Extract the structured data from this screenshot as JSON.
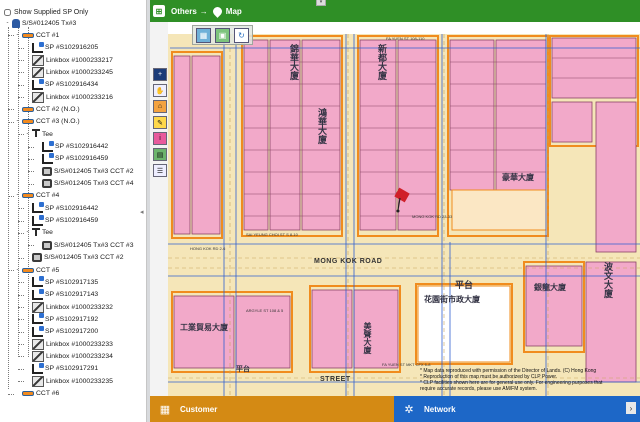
{
  "tree": {
    "show_supplied_label": "Show Supplied SP Only",
    "nodes": [
      {
        "label": "S/S#012405 Tx#3",
        "icon": "root",
        "indent": 0,
        "toggle": "-"
      },
      {
        "label": "CCT #1",
        "icon": "cct",
        "indent": 1,
        "toggle": "-"
      },
      {
        "label": "SP #S102916205",
        "icon": "sp",
        "indent": 2,
        "toggle": ""
      },
      {
        "label": "Linkbox #1000233217",
        "icon": "link",
        "indent": 2,
        "toggle": ""
      },
      {
        "label": "Linkbox #1000233245",
        "icon": "link",
        "indent": 2,
        "toggle": ""
      },
      {
        "label": "SP #S102916434",
        "icon": "sp",
        "indent": 2,
        "toggle": ""
      },
      {
        "label": "Linkbox #1000233216",
        "icon": "link",
        "indent": 2,
        "toggle": ""
      },
      {
        "label": "CCT #2 (N.O.)",
        "icon": "cct",
        "indent": 1,
        "toggle": ""
      },
      {
        "label": "CCT #3 (N.O.)",
        "icon": "cct",
        "indent": 1,
        "toggle": "-"
      },
      {
        "label": "Tee",
        "icon": "tee",
        "indent": 2,
        "toggle": "-"
      },
      {
        "label": "SP #S102916442",
        "icon": "sp",
        "indent": 3,
        "toggle": ""
      },
      {
        "label": "SP #S102916459",
        "icon": "sp",
        "indent": 3,
        "toggle": ""
      },
      {
        "label": "S/S#012405 Tx#3 CCT #2",
        "icon": "tx",
        "indent": 3,
        "toggle": ""
      },
      {
        "label": "S/S#012405 Tx#3 CCT #4",
        "icon": "tx",
        "indent": 3,
        "toggle": ""
      },
      {
        "label": "CCT #4",
        "icon": "cct",
        "indent": 1,
        "toggle": "-"
      },
      {
        "label": "SP #S102916442",
        "icon": "sp",
        "indent": 2,
        "toggle": ""
      },
      {
        "label": "SP #S102916459",
        "icon": "sp",
        "indent": 2,
        "toggle": ""
      },
      {
        "label": "Tee",
        "icon": "tee",
        "indent": 2,
        "toggle": "-"
      },
      {
        "label": "S/S#012405 Tx#3 CCT #3",
        "icon": "tx",
        "indent": 3,
        "toggle": ""
      },
      {
        "label": "S/S#012405 Tx#3 CCT #2",
        "icon": "tx",
        "indent": 2,
        "toggle": ""
      },
      {
        "label": "CCT #5",
        "icon": "cct",
        "indent": 1,
        "toggle": "-"
      },
      {
        "label": "SP #S102917135",
        "icon": "sp",
        "indent": 2,
        "toggle": ""
      },
      {
        "label": "SP #S102917143",
        "icon": "sp",
        "indent": 2,
        "toggle": ""
      },
      {
        "label": "Linkbox #1000233232",
        "icon": "link",
        "indent": 2,
        "toggle": ""
      },
      {
        "label": "SP #S102917192",
        "icon": "sp",
        "indent": 2,
        "toggle": ""
      },
      {
        "label": "SP #S102917200",
        "icon": "sp",
        "indent": 2,
        "toggle": ""
      },
      {
        "label": "Linkbox #1000233233",
        "icon": "link",
        "indent": 2,
        "toggle": ""
      },
      {
        "label": "Linkbox #1000233234",
        "icon": "link",
        "indent": 2,
        "toggle": ""
      },
      {
        "label": "SP #S102917291",
        "icon": "sp",
        "indent": 2,
        "toggle": ""
      },
      {
        "label": "Linkbox #1000233235",
        "icon": "link",
        "indent": 2,
        "toggle": ""
      },
      {
        "label": "CCT #6",
        "icon": "cct",
        "indent": 1,
        "toggle": ""
      }
    ]
  },
  "header": {
    "title_left": "Others",
    "arrow": "→",
    "title_right": "Map"
  },
  "map": {
    "roads": {
      "mong_kok": "MONG KOK ROAD",
      "street_bottom": "STREET"
    },
    "buildings": [
      {
        "text": "錦華大廈"
      },
      {
        "text": "新都大廈"
      },
      {
        "text": "鴻華大廈"
      },
      {
        "text": "平台"
      },
      {
        "text": "花園街市政大廈"
      },
      {
        "text": "工業貿易大廈"
      },
      {
        "text": "美聲大廈"
      },
      {
        "text": "波文大廈"
      },
      {
        "text": "豪華大廈"
      },
      {
        "text": "平台"
      },
      {
        "text": "銀龍大廈"
      }
    ],
    "notes": [
      "SAI YEUNG CHOI ST S 8-10",
      "FA YUEN ST 108-110",
      "MONG KOK RD 23-33",
      "HONG KOK RD 2-6",
      "ARGYLE ST 108 & 5",
      "FA YUEN ST MKT CFX 6-8"
    ],
    "disclaimer": [
      "* Map data reproduced with permission of the Director of Lands. (C) Hong Kong",
      "* Reproduction of this map must be authorized by CLP Power.",
      "* CLP facilities shown here are for general use only. For engineering purposes that",
      "  require accurate records, please use AM/FM system."
    ]
  },
  "bottom": {
    "customer_label": "Customer",
    "network_label": "Network",
    "next": "›"
  },
  "colors": {
    "header_green": "#2f8f26",
    "customer_orange": "#d48a14",
    "network_blue": "#1d67c7",
    "building_pink": "#f2a9c9",
    "road_yellow": "#f5e6b8",
    "lot_orange": "#f08c1e"
  }
}
